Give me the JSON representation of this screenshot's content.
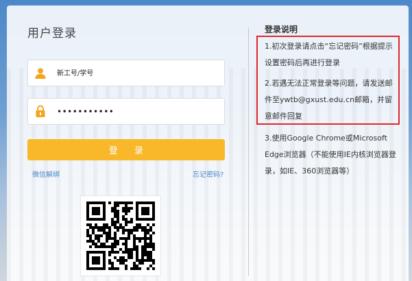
{
  "login": {
    "title": "用户登录",
    "username_placeholder": "新工号/学号",
    "password_value": "•••••••••••",
    "submit_label": "登 录",
    "wechat_unbind": "微信解绑",
    "forgot_password": "忘记密码?"
  },
  "help": {
    "title": "登录说明",
    "item1": "1.初次登录请点击“忘记密码”根据提示设置密码后再进行登录",
    "item2": "2.若遇无法正常登录等问题，请发送邮件至ywtb@gxust.edu.cn邮箱，并留意邮件回复",
    "item3": "3.使用Google Chrome或Microsoft Edge浏览器（不能使用IE内核浏览器登录，如IE、360浏览器等）"
  },
  "colors": {
    "accent": "#f8b82a",
    "link": "#4a86c8",
    "highlight_border": "#e1262a"
  },
  "icons": {
    "user": "user-icon",
    "lock": "lock-icon",
    "qr": "qr-code"
  }
}
